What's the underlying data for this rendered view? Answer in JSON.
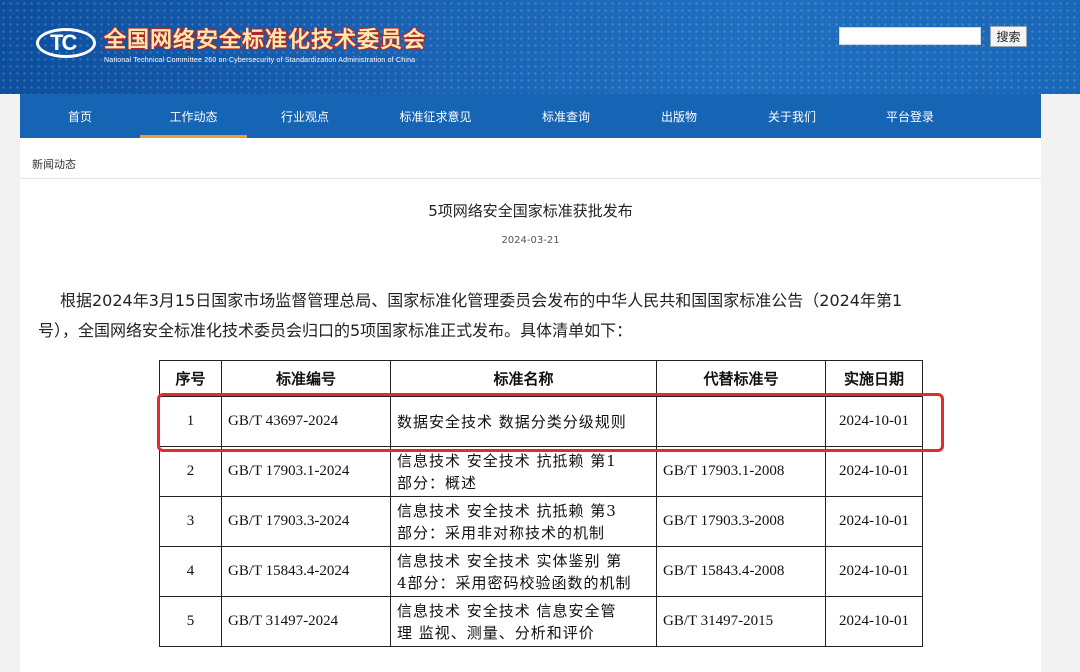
{
  "header": {
    "logo_mark": "TC",
    "site_title": "全国网络安全标准化技术委员会",
    "site_subtitle": "National Technical Committee 260 on Cybersecurity of Standardization Administration of China",
    "search_placeholder": "",
    "search_button": "搜索",
    "colors": {
      "primary": "#1664b4",
      "accent": "#f29a2e",
      "highlight": "#e32b2b"
    }
  },
  "nav": {
    "items": [
      {
        "label": "首页"
      },
      {
        "label": "工作动态",
        "active": true
      },
      {
        "label": "行业观点"
      },
      {
        "label": "标准征求意见"
      },
      {
        "label": "标准查询"
      },
      {
        "label": "出版物"
      },
      {
        "label": "关于我们"
      },
      {
        "label": "平台登录"
      }
    ]
  },
  "breadcrumb": "新闻动态",
  "article": {
    "title": "5项网络安全国家标准获批发布",
    "date": "2024-03-21",
    "paragraph_line1": "根据2024年3月15日国家市场监督管理总局、国家标准化管理委员会发布的中华人民共和国国家标准公告（2024年第1",
    "paragraph_line2": "号），全国网络安全标准化技术委员会归口的5项国家标准正式发布。具体清单如下："
  },
  "table": {
    "headers": [
      "序号",
      "标准编号",
      "标准名称",
      "代替标准号",
      "实施日期"
    ],
    "rows": [
      {
        "no": "1",
        "code": "GB/T 43697-2024",
        "name_line1": "数据安全技术 数据分类分级规则",
        "name_line2": "",
        "replaces": "",
        "date": "2024-10-01"
      },
      {
        "no": "2",
        "code": "GB/T 17903.1-2024",
        "name_line1": "信息技术 安全技术 抗抵赖 第1",
        "name_line2": "部分：概述",
        "replaces": "GB/T 17903.1-2008",
        "date": "2024-10-01"
      },
      {
        "no": "3",
        "code": "GB/T 17903.3-2024",
        "name_line1": "信息技术 安全技术 抗抵赖 第3",
        "name_line2": "部分：采用非对称技术的机制",
        "replaces": "GB/T 17903.3-2008",
        "date": "2024-10-01"
      },
      {
        "no": "4",
        "code": "GB/T 15843.4-2024",
        "name_line1": "信息技术 安全技术 实体鉴别 第",
        "name_line2": "4部分：采用密码校验函数的机制",
        "replaces": "GB/T 15843.4-2008",
        "date": "2024-10-01"
      },
      {
        "no": "5",
        "code": "GB/T 31497-2024",
        "name_line1": "信息技术 安全技术 信息安全管",
        "name_line2": "理 监视、测量、分析和评价",
        "replaces": "GB/T 31497-2015",
        "date": "2024-10-01"
      }
    ]
  }
}
